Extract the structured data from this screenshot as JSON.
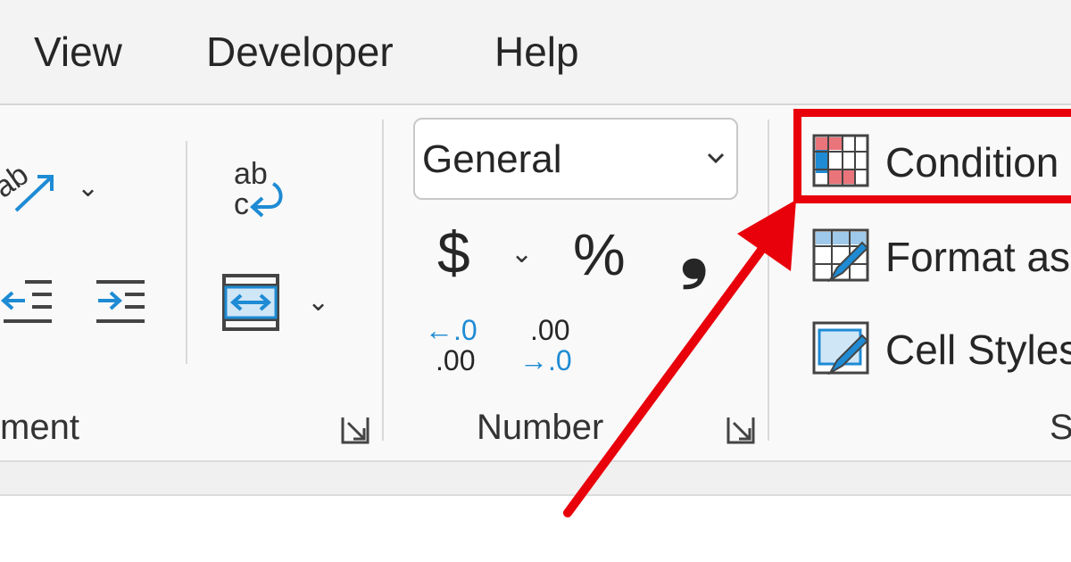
{
  "menu": {
    "tabs": [
      {
        "label": "View"
      },
      {
        "label": "Developer"
      },
      {
        "label": "Help"
      }
    ]
  },
  "groups": {
    "alignment": {
      "label": "ment"
    },
    "number": {
      "label": "Number",
      "format_value": "General",
      "currency_symbol": "$",
      "percent_symbol": "%",
      "comma_symbol": "❟",
      "increase_decimal": {
        "top": "←.0",
        "bottom": ".00"
      },
      "decrease_decimal": {
        "top": ".00",
        "bottom": "→.0"
      }
    },
    "styles": {
      "label": "St",
      "conditional_formatting": "Condition",
      "format_as_table": "Format as",
      "cell_styles": "Cell Styles"
    }
  },
  "icons": {
    "orientation": "ab",
    "wrap_text_top": "ab",
    "wrap_text_bottom": "c"
  },
  "colors": {
    "accent_blue": "#1e8bd4",
    "highlight_red": "#e8000b",
    "icon_red": "#e9747a"
  }
}
